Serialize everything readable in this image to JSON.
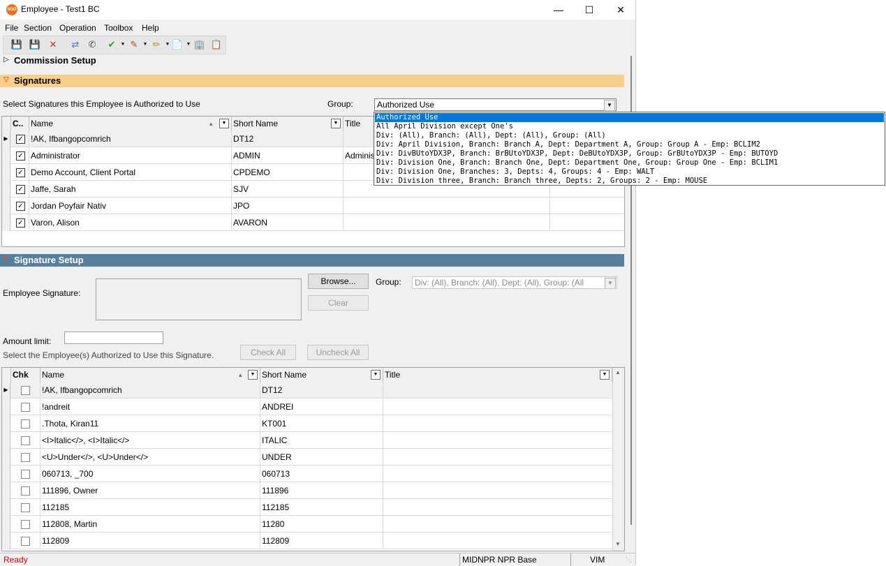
{
  "window": {
    "title": "Employee - Test1 BC",
    "app_icon_text": "SGO"
  },
  "menu": [
    "File",
    "Section",
    "Operation",
    "Toolbox",
    "Help"
  ],
  "sections": {
    "commission": "Commission Setup",
    "signatures": "Signatures",
    "signature_setup": "Signature Setup"
  },
  "signatures": {
    "prompt": "Select Signatures this Employee is Authorized to Use",
    "group_label": "Group:",
    "group_value": "Authorized Use",
    "columns": {
      "chk": "C..",
      "name": "Name",
      "short": "Short Name",
      "title": "Title"
    },
    "rows": [
      {
        "name": "!AK, Ifbangopcomrich",
        "short": "DT12",
        "title": ""
      },
      {
        "name": "Administrator",
        "short": "ADMIN",
        "title": "Administ"
      },
      {
        "name": "Demo Account, Client Portal",
        "short": "CPDEMO",
        "title": ""
      },
      {
        "name": "Jaffe, Sarah",
        "short": "SJV",
        "title": ""
      },
      {
        "name": "Jordan Poyfair Nativ",
        "short": "JPO",
        "title": ""
      },
      {
        "name": "Varon, Alison",
        "short": "AVARON",
        "title": ""
      }
    ]
  },
  "dropdown_options": [
    "Authorized Use",
    "All April Division except One's",
    "Div: (All), Branch: (All), Dept: (All), Group: (All)",
    "Div: April Division, Branch: Branch A, Dept: Department A, Group: Group A - Emp: BCLIM2",
    "Div: DivBUtoYDX3P, Branch: BrBUtoYDX3P, Dept: DeBUtoYDX3P, Group: GrBUtoYDX3P - Emp: BUTOYD",
    "Div: Division One, Branch: Branch One, Dept: Department One, Group: Group One - Emp: BCLIM1",
    "Div: Division One, Branches:   3, Depts:   4, Groups:   4 - Emp: WALT",
    "Div: Division three, Branch: Branch three, Depts:   2, Groups:   2 - Emp: MOUSE"
  ],
  "setup": {
    "employee_signature_label": "Employee Signature:",
    "browse": "Browse...",
    "clear": "Clear",
    "group_label": "Group:",
    "group_value": "Div: (All), Branch: (All), Dept: (All), Group: (All",
    "amount_label": "Amount limit:",
    "amount_value": "",
    "prompt": "Select the Employee(s) Authorized to Use this Signature.",
    "check_all": "Check All",
    "uncheck_all": "Uncheck All",
    "columns": {
      "chk": "Chk",
      "name": "Name",
      "short": "Short Name",
      "title": "Title"
    },
    "rows": [
      {
        "name": "!AK, Ifbangopcomrich",
        "short": "DT12"
      },
      {
        "name": "!andreit",
        "short": "ANDREI"
      },
      {
        "name": ".Thota, Kiran11",
        "short": "KT001"
      },
      {
        "name": "<I>Italic</>, <I>Italic</>",
        "short": "ITALIC"
      },
      {
        "name": "<U>Under</>, <U>Under</>",
        "short": "UNDER"
      },
      {
        "name": "060713, _700",
        "short": "060713"
      },
      {
        "name": "111896, Owner",
        "short": "111896"
      },
      {
        "name": "112185",
        "short": "112185"
      },
      {
        "name": "112808, Martin",
        "short": "11280"
      },
      {
        "name": "112809",
        "short": "112809"
      }
    ]
  },
  "status": {
    "state": "Ready",
    "server": "MIDNPR NPR Base",
    "user": "VIM"
  }
}
